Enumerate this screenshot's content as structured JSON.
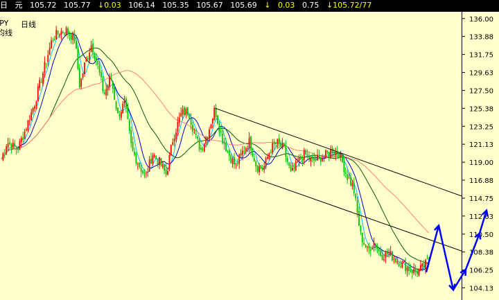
{
  "quote_bar": {
    "period": "日",
    "currency": "元",
    "open": "105.72",
    "close": "105.77",
    "change": "0.03",
    "high": "106.14",
    "low": "105.35",
    "bid": "105.67",
    "ask": "105.69",
    "change2": "0.03",
    "percent": "0.75",
    "range": "105.72/77",
    "up_arrow": "↓",
    "down_arrow": "↓"
  },
  "panel_labels": {
    "symbol": "JPY",
    "timeframe": "日线",
    "indicator": "均线"
  },
  "chart_data": {
    "type": "candlestick",
    "y_axis": {
      "ticks": [
        "136.00",
        "133.88",
        "131.75",
        "129.63",
        "127.50",
        "125.38",
        "123.25",
        "121.13",
        "119.00",
        "116.88",
        "114.75",
        "112.63",
        "110.50",
        "108.38",
        "106.25",
        "104.13"
      ],
      "ylim": [
        102.7,
        136.8
      ]
    },
    "price_path": [
      [
        0,
        118.9
      ],
      [
        10,
        121.4
      ],
      [
        25,
        120.5
      ],
      [
        35,
        122.5
      ],
      [
        50,
        126.0
      ],
      [
        65,
        130.5
      ],
      [
        75,
        133.5
      ],
      [
        85,
        134.4
      ],
      [
        95,
        134.6
      ],
      [
        108,
        133.6
      ],
      [
        115,
        128.0
      ],
      [
        122,
        130.5
      ],
      [
        132,
        133.0
      ],
      [
        140,
        130.8
      ],
      [
        150,
        127.0
      ],
      [
        160,
        129.0
      ],
      [
        170,
        124.5
      ],
      [
        180,
        126.0
      ],
      [
        190,
        120.5
      ],
      [
        200,
        118.8
      ],
      [
        210,
        117.2
      ],
      [
        220,
        120.0
      ],
      [
        230,
        119.0
      ],
      [
        240,
        117.5
      ],
      [
        250,
        122.0
      ],
      [
        262,
        124.8
      ],
      [
        272,
        125.0
      ],
      [
        282,
        122.0
      ],
      [
        290,
        120.5
      ],
      [
        300,
        122.5
      ],
      [
        310,
        125.3
      ],
      [
        320,
        122.0
      ],
      [
        330,
        120.0
      ],
      [
        340,
        118.5
      ],
      [
        350,
        120.2
      ],
      [
        360,
        121.5
      ],
      [
        370,
        118.5
      ],
      [
        380,
        118.2
      ],
      [
        390,
        120.5
      ],
      [
        400,
        121.3
      ],
      [
        410,
        120.5
      ],
      [
        420,
        117.5
      ],
      [
        430,
        119.0
      ],
      [
        440,
        120.0
      ],
      [
        450,
        119.0
      ],
      [
        460,
        119.5
      ],
      [
        470,
        119.8
      ],
      [
        480,
        120.5
      ],
      [
        490,
        120.0
      ],
      [
        500,
        117.5
      ],
      [
        510,
        116.0
      ],
      [
        520,
        110.5
      ],
      [
        530,
        108.5
      ],
      [
        540,
        109.5
      ],
      [
        550,
        108.0
      ],
      [
        560,
        108.2
      ],
      [
        570,
        107.6
      ],
      [
        580,
        107.0
      ],
      [
        590,
        106.4
      ],
      [
        600,
        106.0
      ],
      [
        610,
        106.5
      ],
      [
        620,
        107.5
      ]
    ],
    "ma_series": [
      {
        "color": "#00c0ff",
        "window": 5
      },
      {
        "color": "#0000c0",
        "window": 10
      },
      {
        "color": "#006000",
        "window": 30
      },
      {
        "color": "#ff8080",
        "window": 60
      }
    ],
    "channel": {
      "upper": [
        [
          310,
          125.4
        ],
        [
          666,
          115.0
        ]
      ],
      "lower": [
        [
          375,
          116.9
        ],
        [
          666,
          108.5
        ]
      ]
    },
    "projection": [
      [
        615,
        106.0
      ],
      [
        633,
        111.5
      ],
      [
        654,
        103.9
      ],
      [
        672,
        106.3
      ],
      [
        692,
        110.6
      ],
      [
        702,
        113.3
      ]
    ],
    "projection_colors": {
      "arrow": "#0000ff",
      "candle_up": "#ff0000",
      "candle_down": "#00c000"
    }
  }
}
